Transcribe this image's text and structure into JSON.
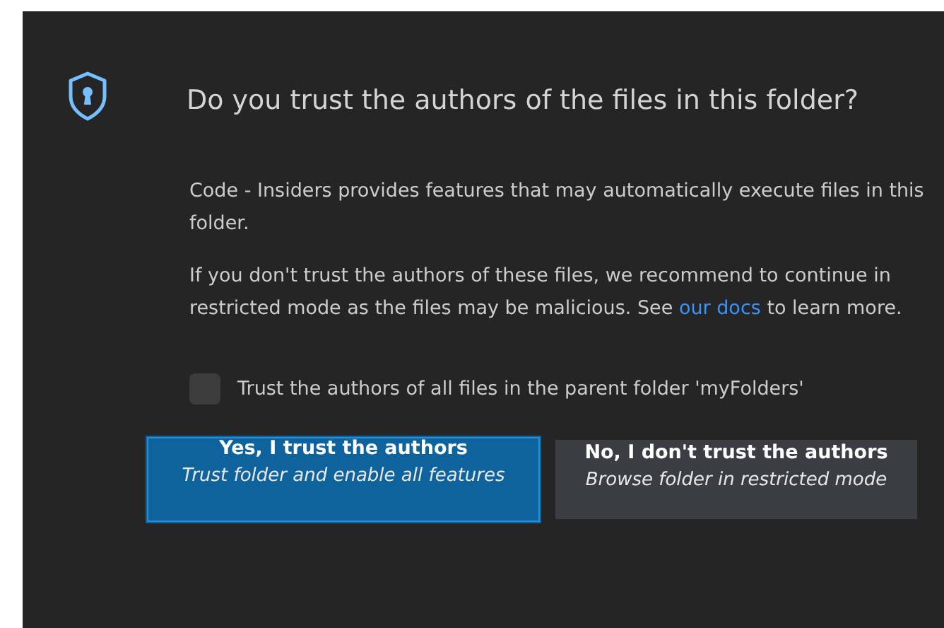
{
  "dialog": {
    "title": "Do you trust the authors of the files in this folder?",
    "paragraphs": [
      {
        "text": "Code - Insiders provides features that may automatically execute files in this folder."
      },
      {
        "text": "If you don't trust the authors of these files, we recommend to continue in restricted mode as the files may be malicious. See ",
        "link": "our docs",
        "after": " to learn more."
      }
    ],
    "checkbox": {
      "label": "Trust the authors of all files in the parent folder 'myFolders'",
      "checked": false
    },
    "buttons": [
      {
        "kind": "primary",
        "label": "Yes, I trust the authors",
        "detail": "Trust folder and enable all features"
      },
      {
        "kind": "secondary",
        "label": "No, I don't trust the authors",
        "detail": "Browse folder in restricted mode"
      }
    ]
  }
}
